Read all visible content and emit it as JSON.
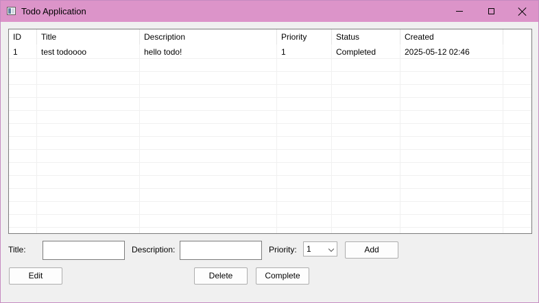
{
  "window": {
    "title": "Todo Application",
    "app_icon": "app-icon",
    "controls": {
      "minimize": "minimize-icon",
      "maximize": "maximize-icon",
      "close": "close-icon"
    },
    "titlebar_color": "#dc94c9"
  },
  "table": {
    "columns": [
      "ID",
      "Title",
      "Description",
      "Priority",
      "Status",
      "Created"
    ],
    "rows": [
      [
        "1",
        "test todoooo",
        "hello todo!",
        "1",
        "Completed",
        "2025-05-12 02:46"
      ]
    ]
  },
  "form": {
    "title_label": "Title:",
    "title_value": "",
    "description_label": "Description:",
    "description_value": "",
    "priority_label": "Priority:",
    "priority_value": "1",
    "add_label": "Add"
  },
  "actions": {
    "edit_label": "Edit",
    "delete_label": "Delete",
    "complete_label": "Complete"
  }
}
